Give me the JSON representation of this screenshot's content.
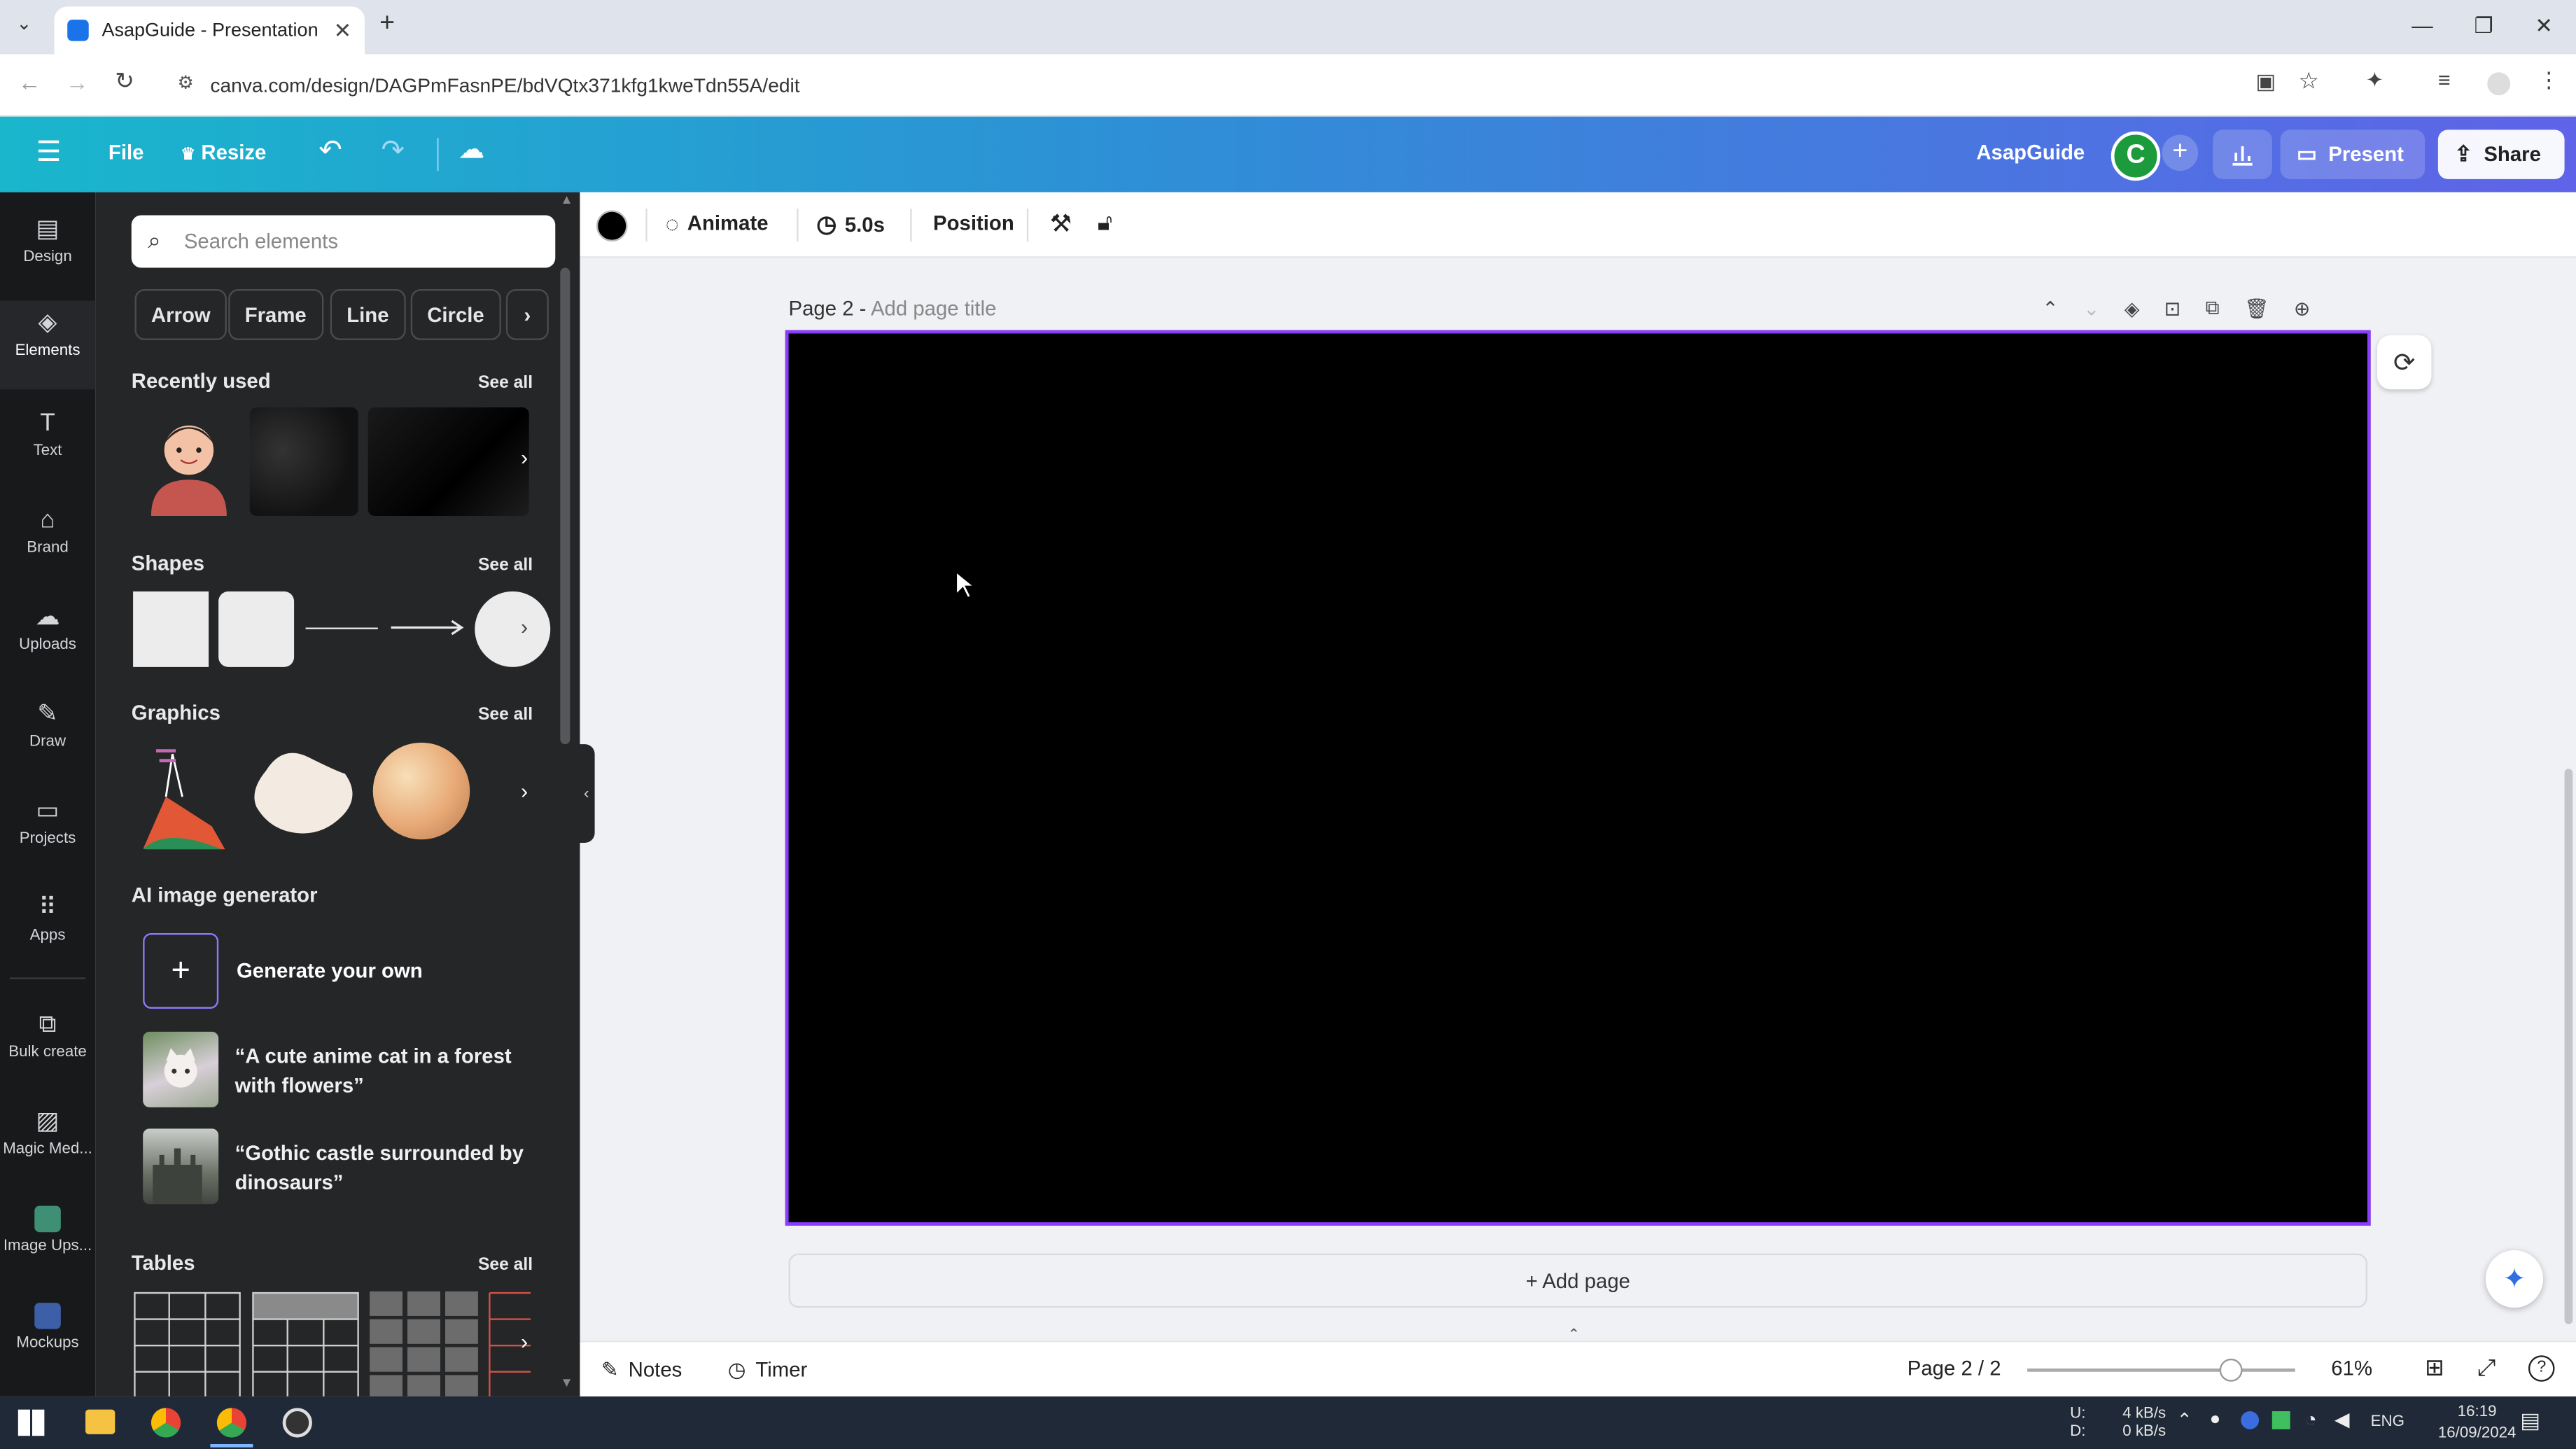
{
  "browser": {
    "tab_title": "AsapGuide - Presentation",
    "url": "canva.com/design/DAGPmFasnPE/bdVQtx371kfg1kweTdn55A/edit"
  },
  "header": {
    "menu_icon": "hamburger-icon",
    "file": "File",
    "resize": "Resize",
    "project_name": "AsapGuide",
    "avatar_letter": "C",
    "present": "Present",
    "share": "Share",
    "gradient_colors": [
      "#19b6cc",
      "#5f63e8"
    ]
  },
  "rail": {
    "items": [
      {
        "label": "Design",
        "icon": "design-icon"
      },
      {
        "label": "Elements",
        "icon": "elements-icon"
      },
      {
        "label": "Text",
        "icon": "text-icon"
      },
      {
        "label": "Brand",
        "icon": "brand-icon"
      },
      {
        "label": "Uploads",
        "icon": "uploads-icon"
      },
      {
        "label": "Draw",
        "icon": "draw-icon"
      },
      {
        "label": "Projects",
        "icon": "projects-icon"
      },
      {
        "label": "Apps",
        "icon": "apps-icon"
      },
      {
        "label": "Bulk create",
        "icon": "bulk-create-icon"
      },
      {
        "label": "Magic Med...",
        "icon": "magic-media-icon"
      },
      {
        "label": "Image Ups...",
        "icon": "image-upscaler-icon"
      },
      {
        "label": "Mockups",
        "icon": "mockups-icon"
      }
    ],
    "active": "Elements"
  },
  "panel": {
    "search_placeholder": "Search elements",
    "chips": [
      "Arrow",
      "Frame",
      "Line",
      "Circle"
    ],
    "recently_used": "Recently used",
    "shapes": "Shapes",
    "graphics": "Graphics",
    "ai_generator": "AI image generator",
    "generate_own": "Generate your own",
    "prompt1_line1": "“A cute anime cat in a forest",
    "prompt1_line2": "with flowers”",
    "prompt2_line1": "“Gothic castle surrounded by",
    "prompt2_line2": "dinosaurs”",
    "tables": "Tables",
    "see_all": "See all"
  },
  "toolbar": {
    "fill_color": "#000000",
    "animate": "Animate",
    "duration": "5.0s",
    "position": "Position"
  },
  "canvas": {
    "page_label": "Page 2 - ",
    "page_title_placeholder": "Add page title",
    "slide_color": "#000000",
    "add_page": "+ Add page"
  },
  "bottom": {
    "notes": "Notes",
    "timer": "Timer",
    "page_counter": "Page 2 / 2",
    "zoom_fraction": 0.61,
    "zoom": "61%"
  },
  "taskbar": {
    "net_up_label": "U:",
    "net_down_label": "D:",
    "net_up": "4 kB/s",
    "net_down": "0 kB/s",
    "lang": "ENG",
    "time": "16:19",
    "date": "16/09/2024"
  }
}
